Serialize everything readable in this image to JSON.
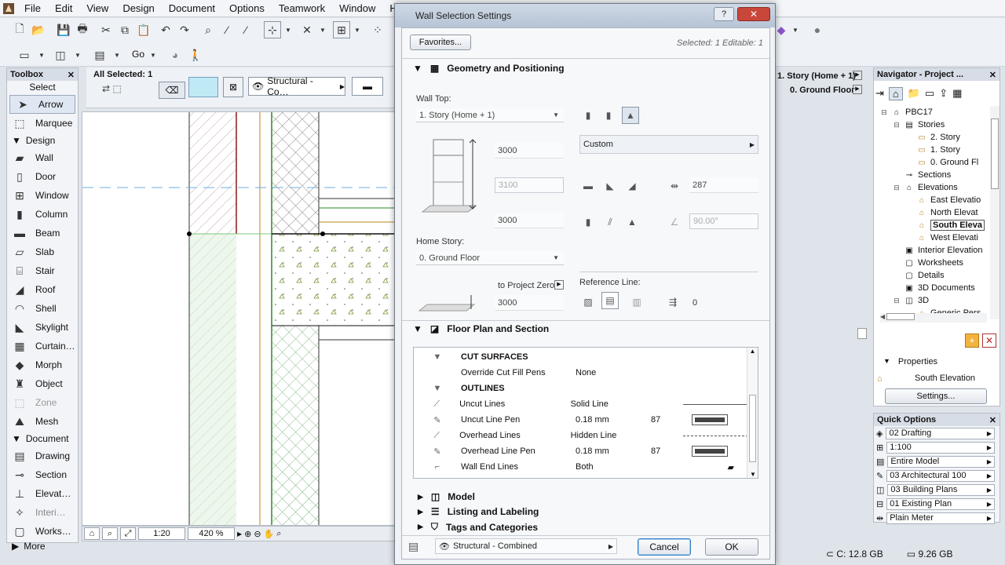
{
  "menu": [
    "File",
    "Edit",
    "View",
    "Design",
    "Document",
    "Options",
    "Teamwork",
    "Window",
    "Help"
  ],
  "toolbar": {
    "go_label": "Go"
  },
  "toolbox": {
    "title": "Toolbox",
    "select": "Select",
    "arrow": "Arrow",
    "marquee": "Marquee",
    "design_group": "Design",
    "design_tools": [
      "Wall",
      "Door",
      "Window",
      "Column",
      "Beam",
      "Slab",
      "Stair",
      "Roof",
      "Shell",
      "Skylight",
      "Curtain…",
      "Morph",
      "Object",
      "Zone",
      "Mesh"
    ],
    "document_group": "Document",
    "document_tools": [
      "Drawing",
      "Section",
      "Elevat…",
      "Interi…",
      "Works…"
    ],
    "more": "More"
  },
  "infobox": {
    "selected": "All Selected: 1",
    "layer": "Structural - Co…",
    "story": "1. Story (Home + 1)",
    "ground": "0. Ground Floor"
  },
  "statusbar": {
    "scale": "1:20",
    "zoom": "420 %"
  },
  "dialog": {
    "title": "Wall Selection Settings",
    "favorites": "Favorites...",
    "selected_info": "Selected: 1 Editable: 1",
    "geometry": "Geometry and Positioning",
    "wall_top_label": "Wall Top:",
    "wall_top_value": "1. Story (Home + 1)",
    "height_top": "3000",
    "height_mid": "3100",
    "height_bottom": "3000",
    "home_story_label": "Home Story:",
    "home_story_value": "0. Ground Floor",
    "to_project_zero": "to Project Zero",
    "project_zero_value": "3000",
    "custom": "Custom",
    "thickness": "287",
    "angle": "90.00°",
    "reference_line": "Reference Line:",
    "ref_offset": "0",
    "floor_plan": "Floor Plan and Section",
    "cut_surfaces": "CUT SURFACES",
    "override_label": "Override Cut Fill Pens",
    "override_value": "None",
    "outlines": "OUTLINES",
    "rows": [
      {
        "label": "Uncut Lines",
        "value": "Solid Line",
        "extra": ""
      },
      {
        "label": "Uncut Line Pen",
        "value": "0.18 mm",
        "extra": "87"
      },
      {
        "label": "Overhead Lines",
        "value": "Hidden Line",
        "extra": ""
      },
      {
        "label": "Overhead Line Pen",
        "value": "0.18 mm",
        "extra": "87"
      },
      {
        "label": "Wall End Lines",
        "value": "Both",
        "extra": ""
      }
    ],
    "model": "Model",
    "listing": "Listing and Labeling",
    "tags": "Tags and Categories",
    "layer": "Structural - Combined",
    "cancel": "Cancel",
    "ok": "OK"
  },
  "navigator": {
    "title": "Navigator - Project ...",
    "tree": [
      {
        "label": "PBC17",
        "level": 0,
        "toggle": "⊟"
      },
      {
        "label": "Stories",
        "level": 1,
        "toggle": "⊟"
      },
      {
        "label": "2. Story",
        "level": 2,
        "toggle": ""
      },
      {
        "label": "1. Story",
        "level": 2,
        "toggle": ""
      },
      {
        "label": "0. Ground Fl",
        "level": 2,
        "toggle": ""
      },
      {
        "label": "Sections",
        "level": 1,
        "toggle": ""
      },
      {
        "label": "Elevations",
        "level": 1,
        "toggle": "⊟"
      },
      {
        "label": "East Elevatio",
        "level": 2,
        "toggle": ""
      },
      {
        "label": "North Elevat",
        "level": 2,
        "toggle": ""
      },
      {
        "label": "South Eleva",
        "level": 2,
        "toggle": ""
      },
      {
        "label": "West Elevati",
        "level": 2,
        "toggle": ""
      },
      {
        "label": "Interior Elevation",
        "level": 1,
        "toggle": ""
      },
      {
        "label": "Worksheets",
        "level": 1,
        "toggle": ""
      },
      {
        "label": "Details",
        "level": 1,
        "toggle": ""
      },
      {
        "label": "3D Documents",
        "level": 1,
        "toggle": ""
      },
      {
        "label": "3D",
        "level": 1,
        "toggle": "⊟"
      },
      {
        "label": "Generic Pers",
        "level": 2,
        "toggle": ""
      }
    ],
    "properties": "Properties",
    "properties_value": "South Elevation",
    "settings": "Settings..."
  },
  "quick": {
    "title": "Quick Options",
    "items": [
      "02 Drafting",
      "1:100",
      "Entire Model",
      "03 Architectural 100",
      "03 Building Plans",
      "01 Existing Plan",
      "Plain Meter"
    ]
  },
  "system": {
    "disk_c": "C: 12.8 GB",
    "disk_free": "9.26 GB"
  }
}
